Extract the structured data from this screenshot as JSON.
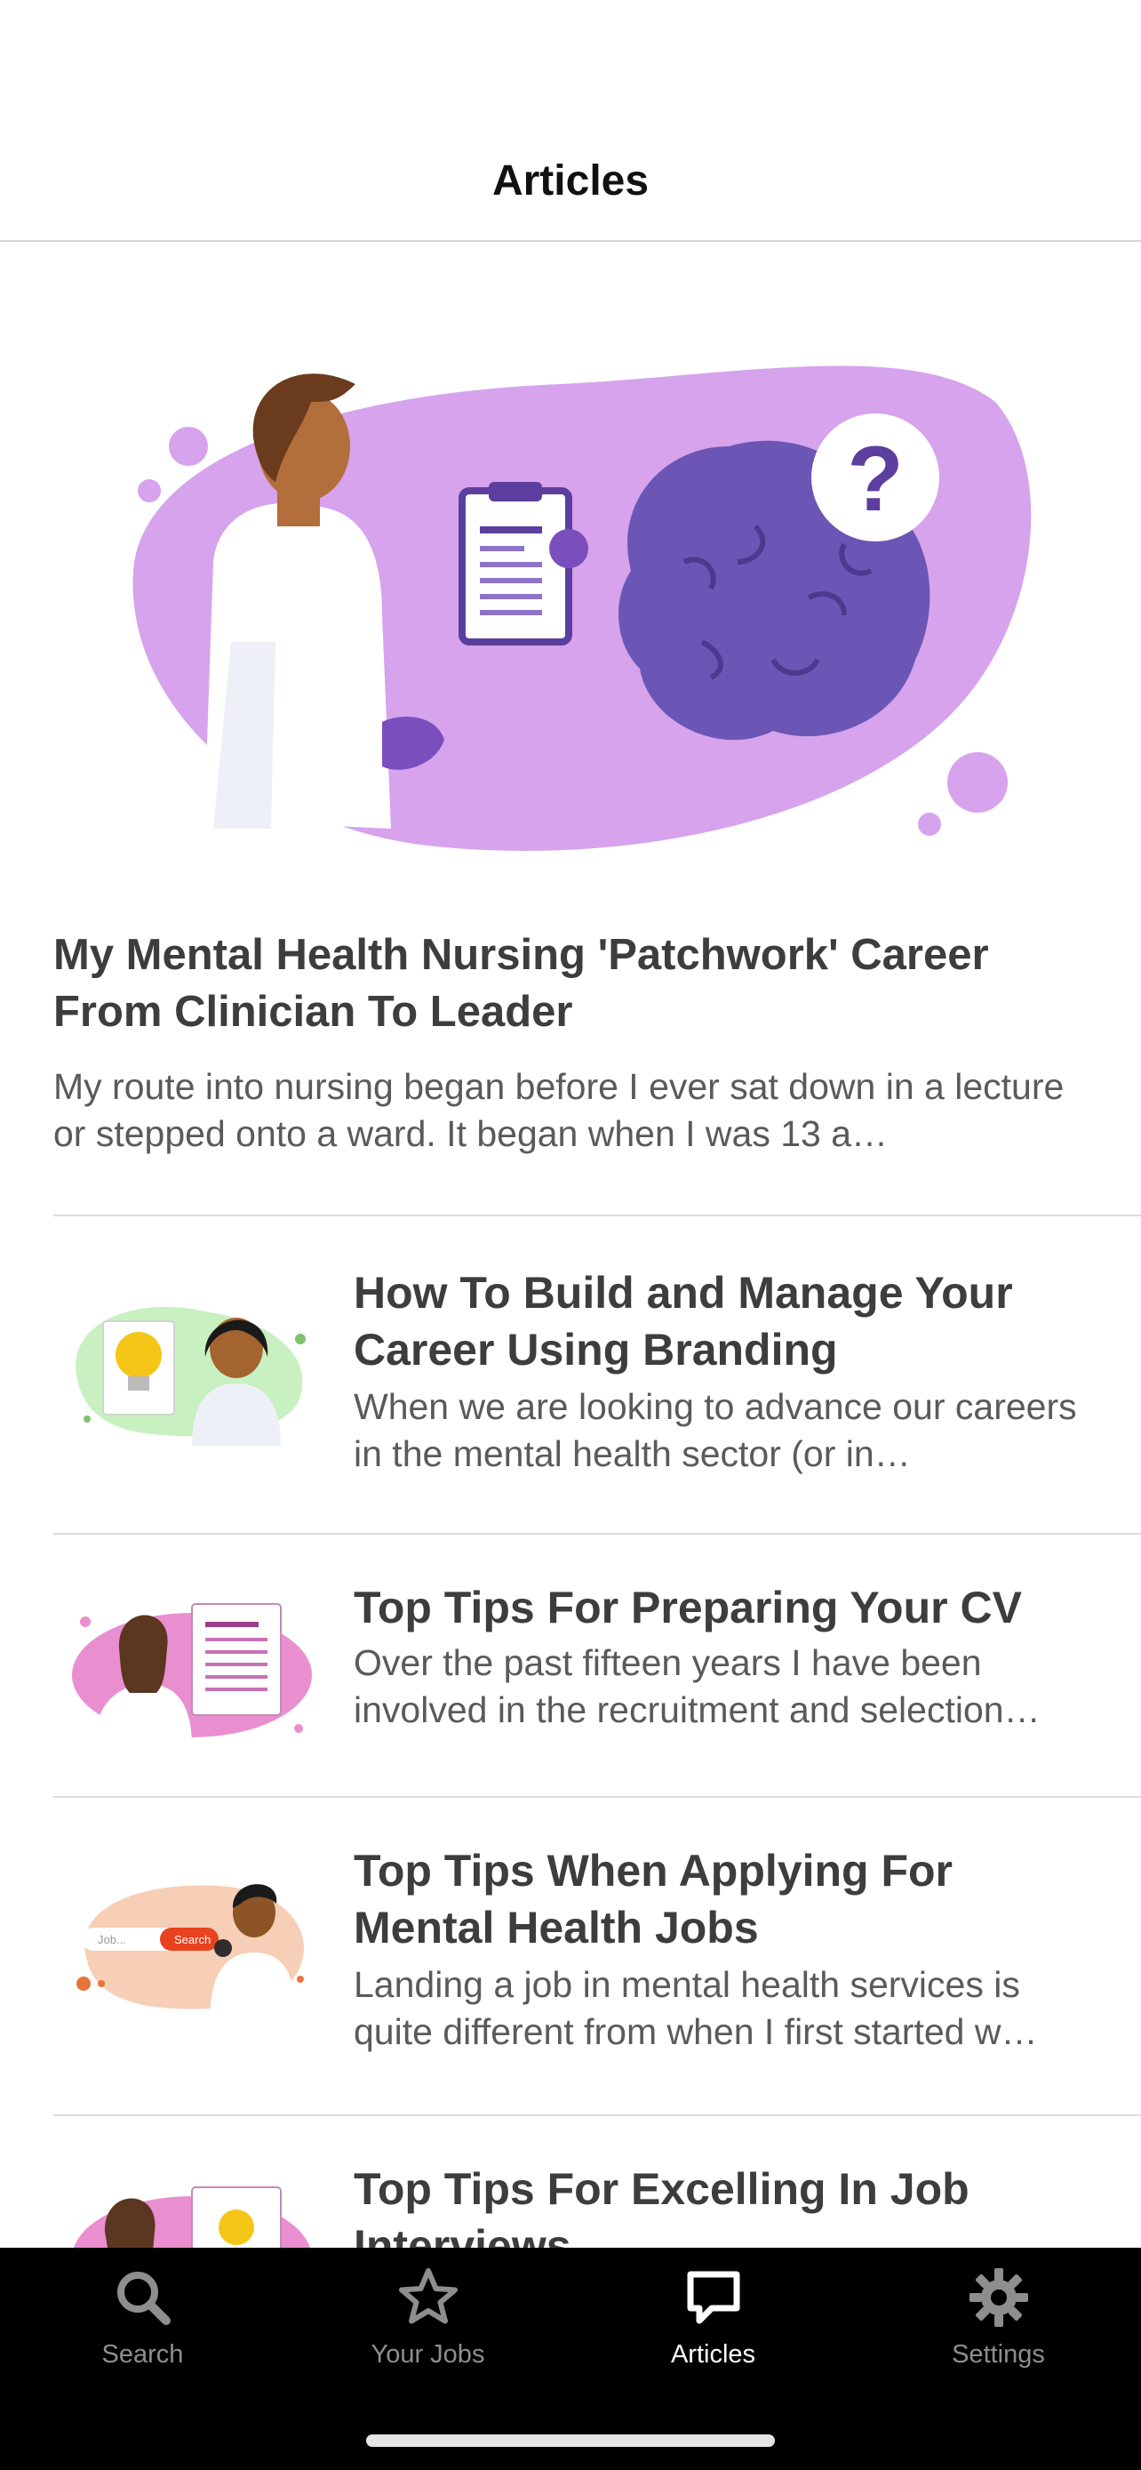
{
  "header": {
    "title": "Articles"
  },
  "featured": {
    "title": "My Mental Health Nursing 'Patchwork' Career From Clinician To Leader",
    "excerpt": "My route into nursing began before I ever sat down in a lecture or stepped onto a ward. It began when I was 13 a…",
    "image": {
      "icon": "doctor-brain-question-illustration",
      "accent": "#d6a3ec"
    }
  },
  "articles": [
    {
      "title": "How To Build and Manage Your Career Using Branding",
      "excerpt": "When we are looking to advance our careers in the mental health sector (or in…",
      "image": {
        "icon": "lightbulb-branding-illustration",
        "accent": "#c9f0c0"
      }
    },
    {
      "title": "Top Tips For Preparing Your CV",
      "excerpt": "Over the past fifteen years I have been involved in the recruitment and selection…",
      "image": {
        "icon": "cv-document-illustration",
        "accent": "#e98fd0"
      }
    },
    {
      "title": "Top Tips When Applying For Mental Health Jobs",
      "excerpt": "Landing a job in mental health services is quite different from when I first started w…",
      "image": {
        "icon": "job-search-illustration",
        "accent": "#f6cfb6",
        "search_placeholder": "Job...",
        "search_button": "Search"
      }
    },
    {
      "title": "Top Tips For Excelling In Job Interviews",
      "excerpt": "",
      "image": {
        "icon": "interview-illustration",
        "accent": "#e98fd0"
      }
    }
  ],
  "tabbar": {
    "tabs": [
      {
        "label": "Search",
        "icon": "search-icon"
      },
      {
        "label": "Your Jobs",
        "icon": "star-icon"
      },
      {
        "label": "Articles",
        "icon": "chat-bubble-icon",
        "active": true
      },
      {
        "label": "Settings",
        "icon": "gear-icon"
      }
    ],
    "active_color": "#ffffff",
    "inactive_color": "#8e8e8e"
  }
}
